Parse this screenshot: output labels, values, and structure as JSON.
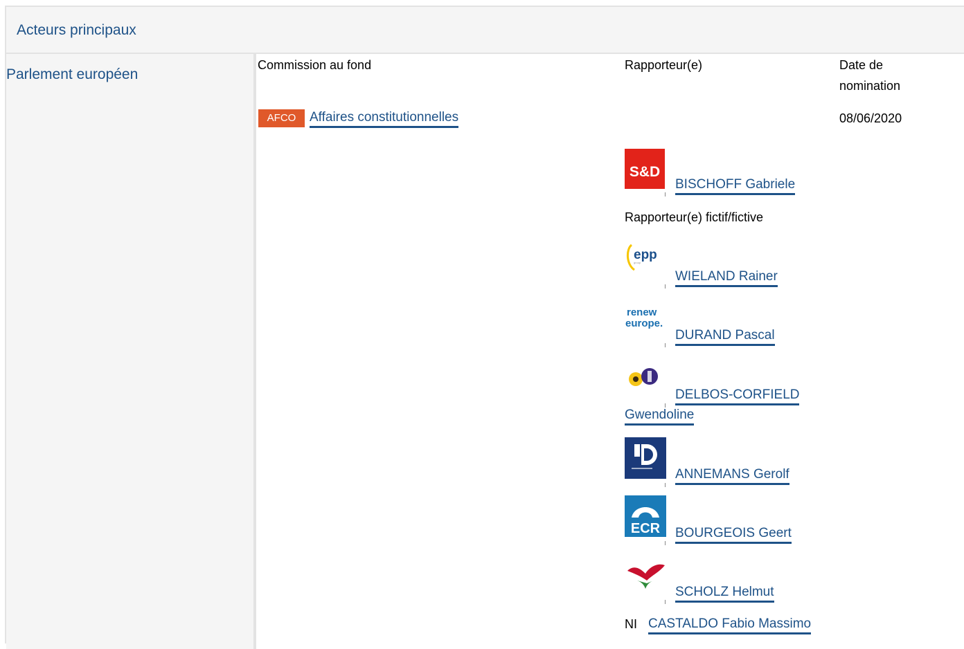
{
  "header": {
    "title": "Acteurs principaux"
  },
  "institution": {
    "name": "Parlement européen"
  },
  "columns": {
    "committee": "Commission au fond",
    "rapporteur": "Rapporteur(e)",
    "date_line1": "Date de",
    "date_line2": "nomination"
  },
  "committee": {
    "code": "AFCO",
    "name": "Affaires constitutionnelles",
    "date": "08/06/2020"
  },
  "rapporteur": {
    "group_logo": "S&D",
    "name": "BISCHOFF Gabriele"
  },
  "shadow_label": "Rapporteur(e) fictif/fictive",
  "shadows": [
    {
      "group_logo": "epp",
      "name": "WIELAND Rainer"
    },
    {
      "group_logo": "renew europe.",
      "name": "DURAND Pascal"
    },
    {
      "group_logo": "greens-efa",
      "name_line1": "DELBOS-CORFIELD",
      "name_line2": "Gwendoline"
    },
    {
      "group_logo": "ID",
      "name": "ANNEMANS Gerolf"
    },
    {
      "group_logo": "ECR",
      "name": "BOURGEOIS Geert"
    },
    {
      "group_logo": "gue-ngl",
      "name": "SCHOLZ Helmut"
    }
  ],
  "ni": {
    "label": "NI",
    "name": "CASTALDO Fabio Massimo"
  },
  "colors": {
    "link": "#1e5288",
    "badge": "#e0592a",
    "panel_bg": "#f5f5f5"
  }
}
